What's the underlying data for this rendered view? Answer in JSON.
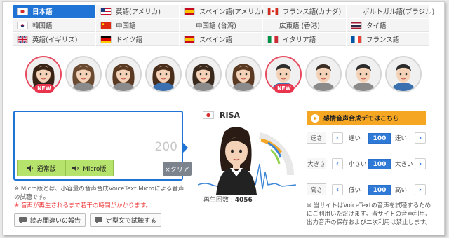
{
  "languages": [
    {
      "label": "日本語",
      "flag": "jp",
      "active": true
    },
    {
      "label": "英語(アメリカ)",
      "flag": "us"
    },
    {
      "label": "スペイン語(アメリカ)",
      "flag": "es"
    },
    {
      "label": "フランス語(カナダ)",
      "flag": "ca"
    },
    {
      "label": "ポルトガル語(ブラジル)",
      "flag": "none"
    },
    {
      "label": "韓国語",
      "flag": "kr"
    },
    {
      "label": "中国語",
      "flag": "cn"
    },
    {
      "label": "中国語 (台湾)",
      "flag": "none"
    },
    {
      "label": "広東語 (香港)",
      "flag": "none"
    },
    {
      "label": "タイ語",
      "flag": "th"
    },
    {
      "label": "英語(イギリス)",
      "flag": "gb"
    },
    {
      "label": "ドイツ語",
      "flag": "de"
    },
    {
      "label": "スペイン語",
      "flag": "es"
    },
    {
      "label": "イタリア語",
      "flag": "it"
    },
    {
      "label": "フランス語",
      "flag": "fr"
    }
  ],
  "avatars": [
    {
      "name": "risa-avatar",
      "new": true,
      "selected": true
    },
    {
      "name": "avatar-2"
    },
    {
      "name": "avatar-3"
    },
    {
      "name": "avatar-4"
    },
    {
      "name": "avatar-5"
    },
    {
      "name": "avatar-6"
    },
    {
      "name": "avatar-7",
      "new": true
    },
    {
      "name": "avatar-8"
    },
    {
      "name": "avatar-9"
    },
    {
      "name": "avatar-10"
    }
  ],
  "badge_new": "NEW",
  "editor": {
    "counter": "200",
    "mode_standard": "通常版",
    "mode_micro": "Micro版",
    "clear": "×クリア"
  },
  "notes": {
    "line1": "※ Micro版とは、小容量の音声合成VoiceText Microによる音声の試聴です。",
    "line2": "※ 音声が再生されるまで若干の時間がかかります。"
  },
  "actions": {
    "report": "読み間違いの報告",
    "template": "定型文で試聴する"
  },
  "speaker": {
    "name": "RISA",
    "play_label": "再生回数 : ",
    "play_count": "4056"
  },
  "demo_button": "感情音声合成デモはこちら",
  "params": [
    {
      "label": "速さ",
      "low": "遅い",
      "value": "100",
      "high": "速い"
    },
    {
      "label": "大きさ",
      "low": "小さい",
      "value": "100",
      "high": "大きい"
    },
    {
      "label": "高さ",
      "low": "低い",
      "value": "100",
      "high": "高い"
    }
  ],
  "right_notes": "※ 当サイトはVoiceTextの音声を試聴するためにご利用いただけます。当サイトの音声利用、出力音声の保存および二次利用は禁止します。",
  "colors": {
    "accent": "#1f74d6",
    "demo": "#f5a623",
    "mode": "#b6e36b",
    "new": "#e8344d"
  }
}
